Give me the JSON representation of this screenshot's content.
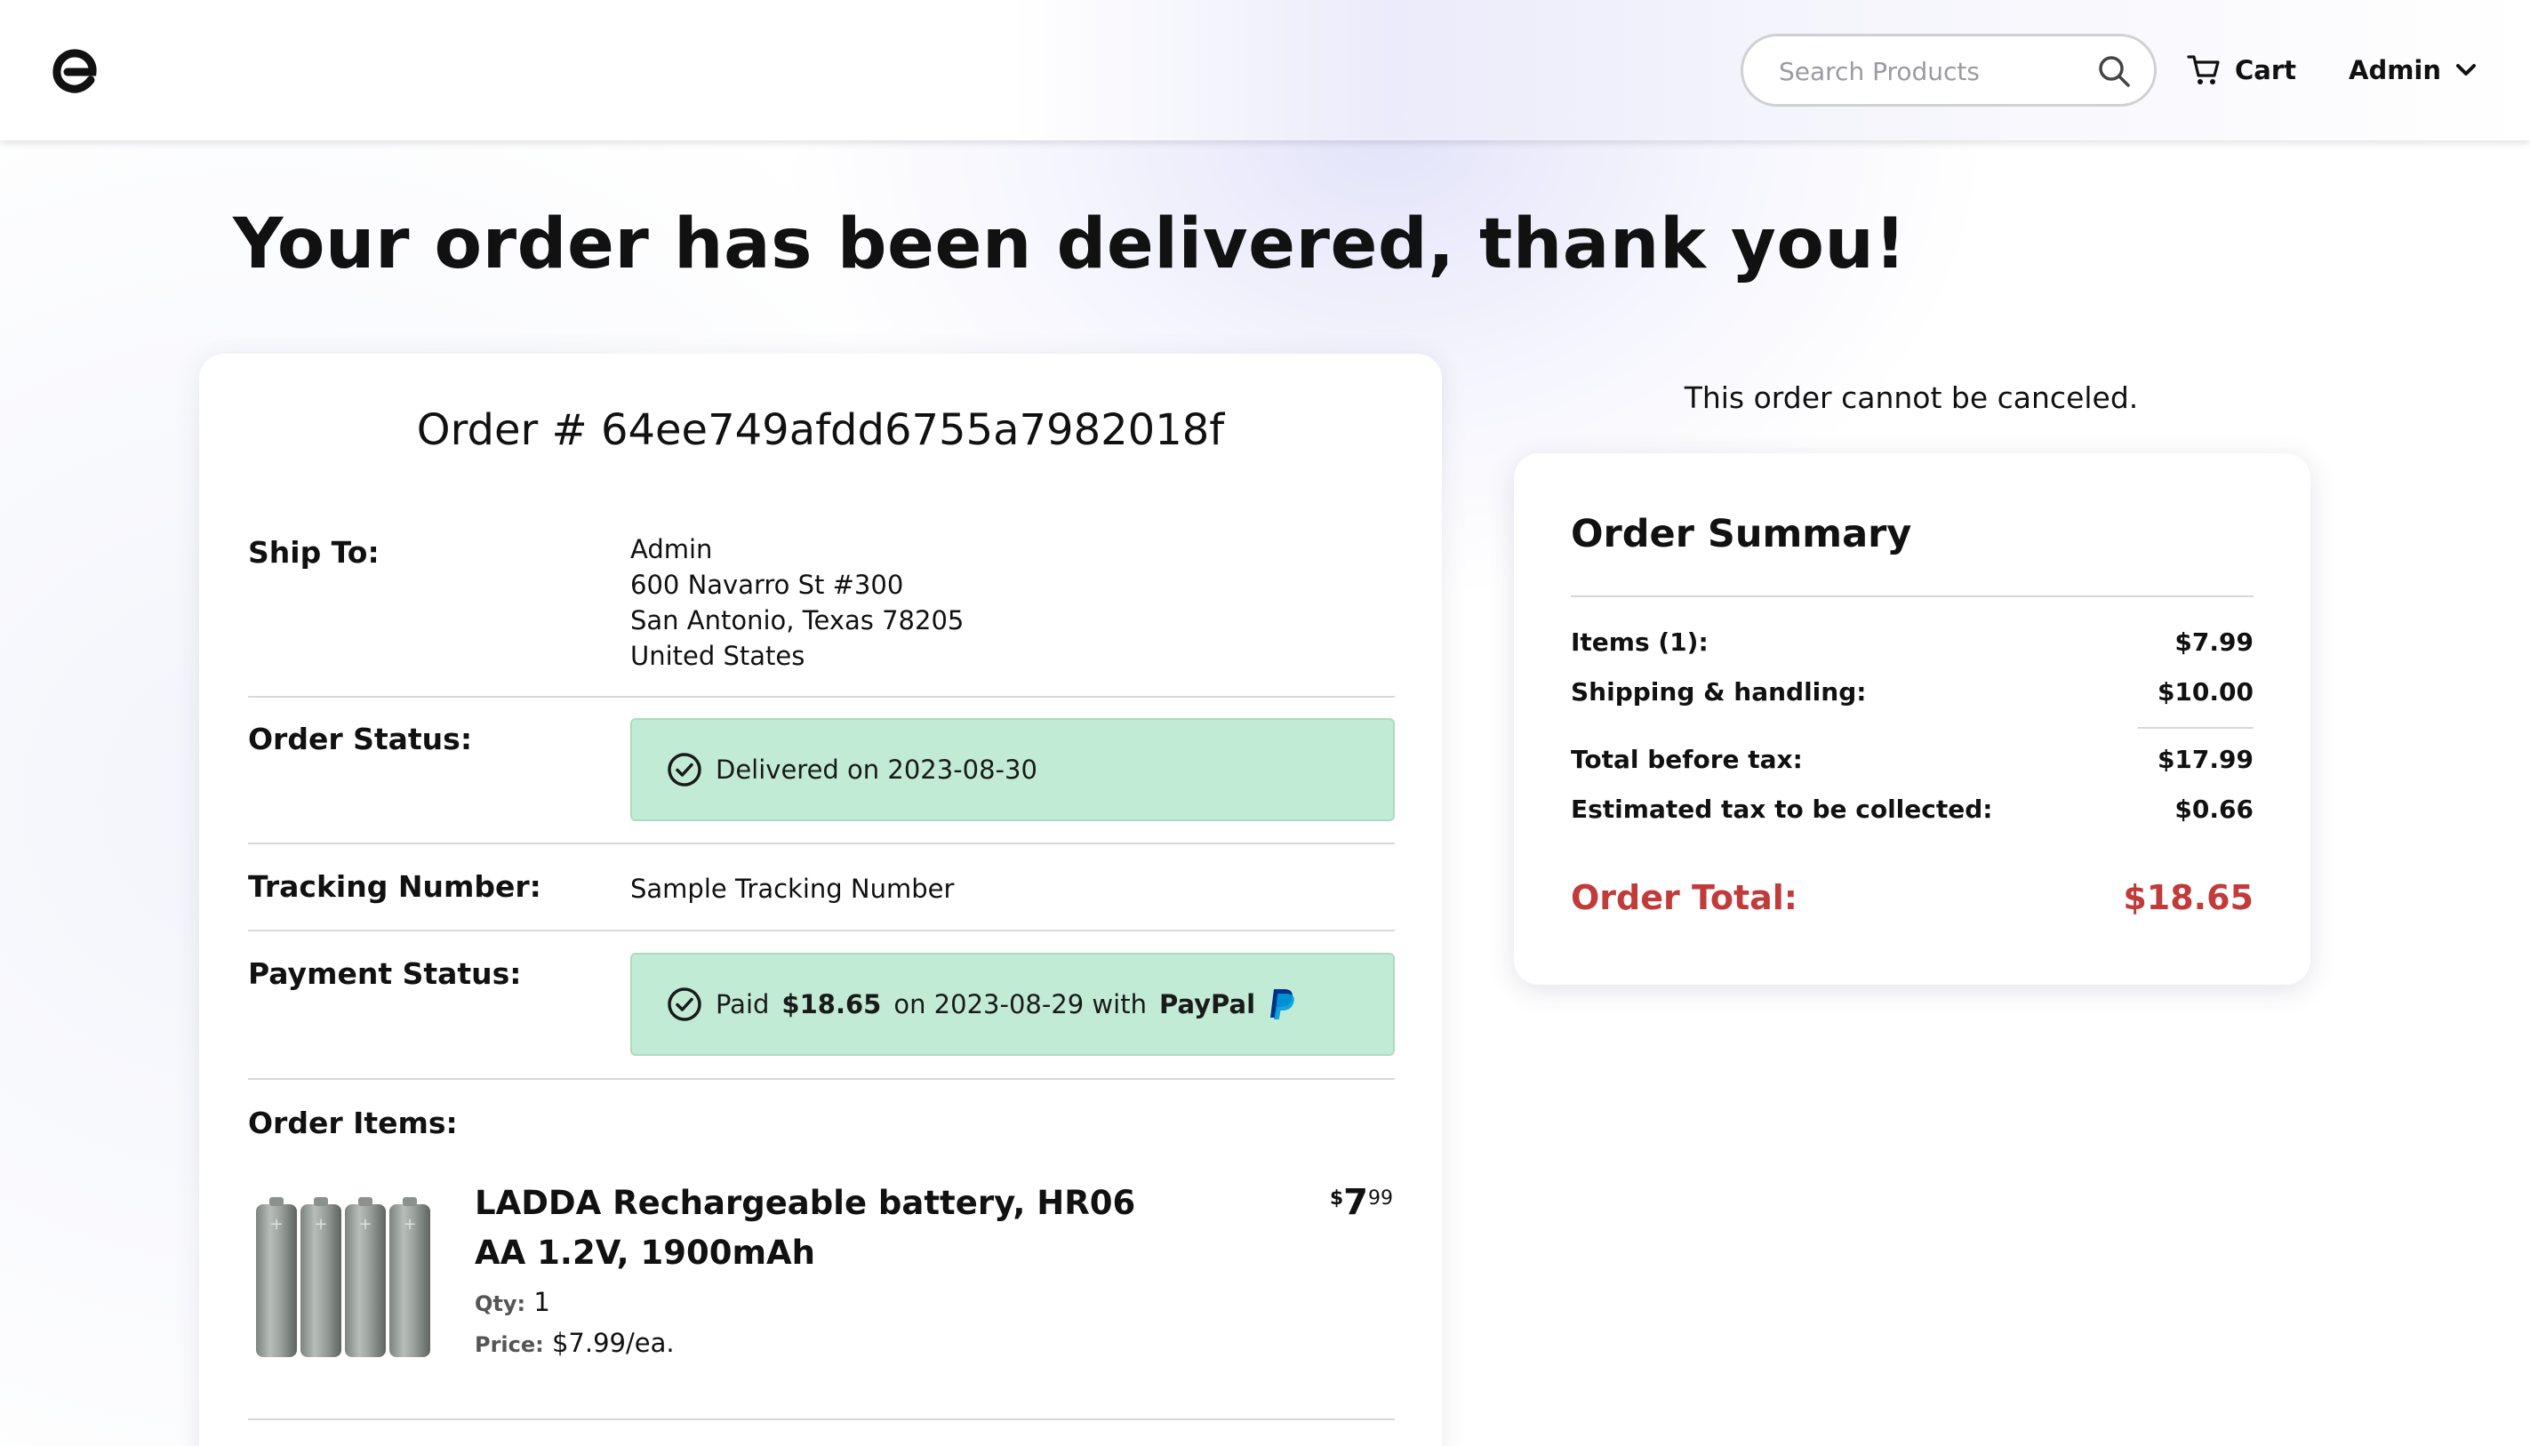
{
  "header": {
    "search_placeholder": "Search Products",
    "cart_label": "Cart",
    "user_label": "Admin"
  },
  "page": {
    "title": "Your order has been delivered, thank you!"
  },
  "order": {
    "number_label": "Order # 64ee749afdd6755a7982018f",
    "ship_to_label": "Ship To:",
    "ship_to": {
      "name": "Admin",
      "street": "600 Navarro St #300",
      "city_state_zip": "San Antonio, Texas 78205",
      "country": "United States"
    },
    "status_label": "Order Status:",
    "status_text": "Delivered on 2023-08-30",
    "tracking_label": "Tracking Number:",
    "tracking_value": "Sample Tracking Number",
    "payment_label": "Payment Status:",
    "payment": {
      "prefix": "Paid",
      "amount": "$18.65",
      "middle": "on 2023-08-29 with",
      "method": "PayPal"
    },
    "items_label": "Order Items:",
    "items": [
      {
        "name": "LADDA Rechargeable battery, HR06 AA 1.2V, 1900mAh",
        "price_symbol": "$",
        "price_whole": "7",
        "price_cents": "99",
        "qty_label": "Qty:",
        "qty": "1",
        "unit_price_label": "Price:",
        "unit_price": "$7.99/ea."
      }
    ]
  },
  "cancel_note": "This order cannot be canceled.",
  "summary": {
    "title": "Order Summary",
    "rows": [
      {
        "label": "Items (1):",
        "value": "$7.99"
      },
      {
        "label": "Shipping & handling:",
        "value": "$10.00"
      },
      {
        "label": "Total before tax:",
        "value": "$17.99"
      },
      {
        "label": "Estimated tax to be collected:",
        "value": "$0.66"
      }
    ],
    "total_label": "Order Total:",
    "total_value": "$18.65"
  },
  "colors": {
    "success_bg": "#c2ebd6",
    "total_red": "#c23b3b",
    "paypal_dark": "#003087",
    "paypal_light": "#009cde"
  }
}
